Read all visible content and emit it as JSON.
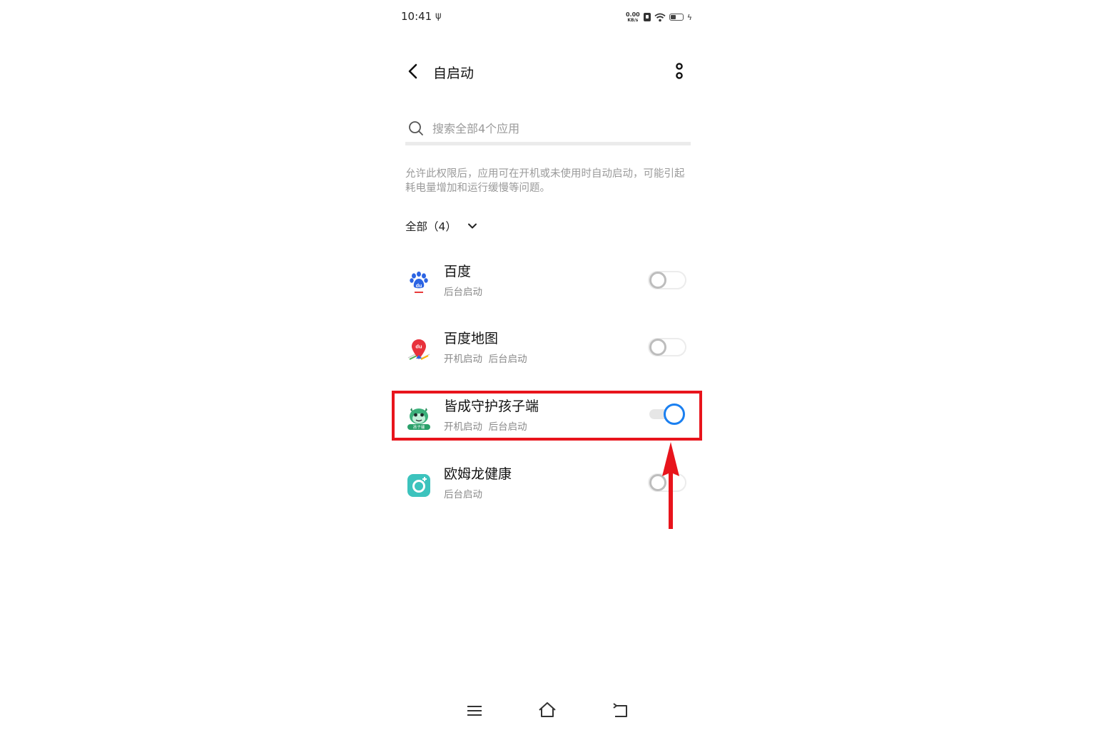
{
  "status_bar": {
    "time": "10:41",
    "net_speed_value": "0.00",
    "net_speed_unit": "KB/s",
    "battery_level": 0.5
  },
  "header": {
    "title": "自启动"
  },
  "search": {
    "placeholder": "搜索全部4个应用"
  },
  "description": "允许此权限后，应用可在开机或未使用时自动启动，可能引起耗电量增加和运行缓慢等问题。",
  "filter": {
    "label": "全部（4）"
  },
  "apps": [
    {
      "name": "百度",
      "subtitle": "后台启动",
      "enabled": false,
      "icon": "baidu-app-icon"
    },
    {
      "name": "百度地图",
      "subtitle": "开机启动  后台启动",
      "enabled": false,
      "icon": "baidu-map-app-icon"
    },
    {
      "name": "皆成守护孩子端",
      "subtitle": "开机启动  后台启动",
      "enabled": true,
      "icon": "jiecheng-child-app-icon",
      "icon_badge": "孩子端"
    },
    {
      "name": "欧姆龙健康",
      "subtitle": "后台启动",
      "enabled": false,
      "icon": "omron-health-app-icon"
    }
  ],
  "colors": {
    "toggle_on": "#1a7ff0",
    "highlight": "#e8141c"
  }
}
